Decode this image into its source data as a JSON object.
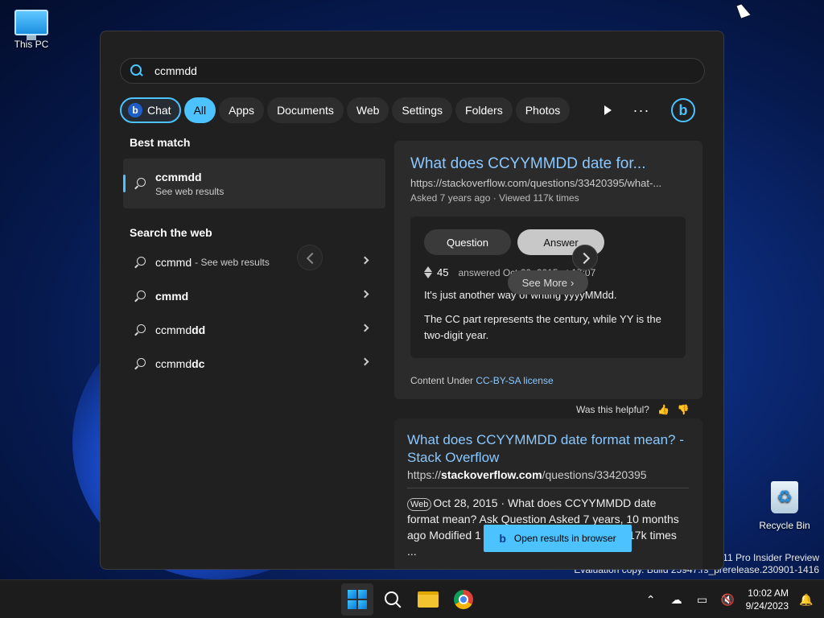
{
  "desktop": {
    "this_pc_label": "This PC",
    "recycle_bin_label": "Recycle Bin",
    "watermark_line1": "s 11 Pro Insider Preview",
    "watermark_line2": "Evaluation copy. Build 25947.rs_prerelease.230901-1416"
  },
  "search": {
    "query": "ccmmdd"
  },
  "filters": [
    {
      "label": "Chat"
    },
    {
      "label": "All"
    },
    {
      "label": "Apps"
    },
    {
      "label": "Documents"
    },
    {
      "label": "Web"
    },
    {
      "label": "Settings"
    },
    {
      "label": "Folders"
    },
    {
      "label": "Photos"
    }
  ],
  "best_match": {
    "title": "Best match",
    "name": "ccmmdd",
    "sub": "See web results"
  },
  "search_web": {
    "title": "Search the web",
    "items": [
      {
        "prefix": "ccmmd",
        "bold": "",
        "suffix": " - See web results"
      },
      {
        "prefix": "",
        "bold": "cmmd",
        "suffix": ""
      },
      {
        "prefix": "ccmmd",
        "bold": "dd",
        "suffix": ""
      },
      {
        "prefix": "ccmmd",
        "bold": "dc",
        "suffix": ""
      }
    ]
  },
  "result_card": {
    "title": "What does CCYYMMDD date for...",
    "url": "https://stackoverflow.com/questions/33420395/what-...",
    "meta": "Asked 7 years ago · Viewed 117k times",
    "tab_question": "Question",
    "tab_answer": "Answer",
    "votes": "45",
    "answered": "answered Oct 29, 2015 at 17:07",
    "p1": "It's just another way of writing yyyyMMdd.",
    "p2": "The CC part represents the century, while YY is the two-digit year.",
    "see_more": "See More",
    "license_prefix": "Content Under ",
    "license_link": "CC-BY-SA license",
    "helpful": "Was this helpful?"
  },
  "result2": {
    "title": "What does CCYYMMDD date format mean? - Stack Overflow",
    "url_prefix": "https://",
    "url_bold": "stackoverflow.com",
    "url_suffix": "/questions/33420395",
    "badge": "Web",
    "body": "Oct 28, 2015 · What does CCYYMMDD date format mean? Ask Question Asked 7 years, 10 months ago Modified 1 year, 3 months ago Viewed 117k times ..."
  },
  "open_browser": "Open results in browser",
  "clock": {
    "time": "10:02 AM",
    "date": "9/24/2023"
  },
  "colors": {
    "accent": "#4cc2ff",
    "panel": "#202020"
  }
}
